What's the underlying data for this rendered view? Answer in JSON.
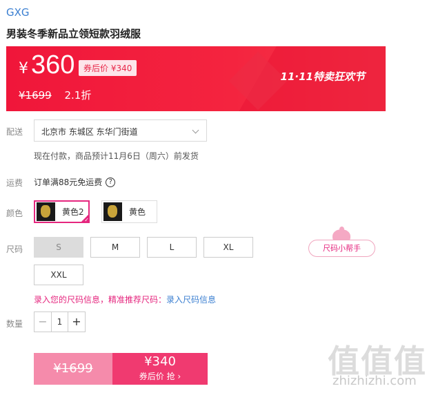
{
  "brand": "GXG",
  "product_title": "男装冬季新品立领短款羽绒服",
  "price": {
    "currency": "¥",
    "current": "360",
    "coupon_price": "券后价 ¥340",
    "original": "¥1699",
    "discount": "2.1折",
    "event": "11·11特卖狂欢节"
  },
  "delivery": {
    "label": "配送",
    "address": "北京市 东城区 东华门街道",
    "note": "现在付款，商品预计11月6日（周六）前发货"
  },
  "freight": {
    "label": "运费",
    "text": "订单满88元免运费",
    "help_glyph": "?"
  },
  "colors": {
    "label": "颜色",
    "options": [
      "黄色2",
      "黄色"
    ],
    "selected": "黄色2"
  },
  "sizes": {
    "label": "尺码",
    "options": [
      "S",
      "M",
      "L",
      "XL",
      "XXL"
    ],
    "disabled": [
      "S"
    ],
    "helper": "尺码小帮手",
    "tip": "录入您的尺码信息，精准推荐尺码：",
    "tip_link": "录入尺码信息"
  },
  "quantity": {
    "label": "数量",
    "value": "1",
    "minus": "−",
    "plus": "+"
  },
  "buy": {
    "original": "¥1699",
    "price": "¥340",
    "cta": "券后价 抢 ›"
  },
  "watermark": {
    "logo": "值值值",
    "url": "zhizhizhi.com"
  },
  "colors_theme": {
    "accent": "#e5267e",
    "banner": "#f0163a",
    "link": "#3b7fd1",
    "buy_button": "#f03a70"
  }
}
